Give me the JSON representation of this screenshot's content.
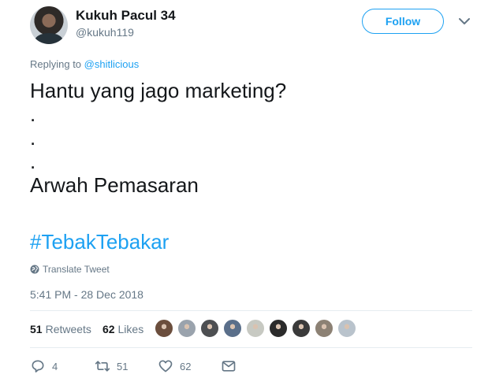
{
  "author": {
    "display_name": "Kukuh Pacul 34",
    "handle": "@kukuh119"
  },
  "follow_button": {
    "label": "Follow"
  },
  "reply": {
    "prefix": "Replying to",
    "mention": "@shitlicious"
  },
  "tweet": {
    "text": "Hantu yang jago marketing?\n.\n.\n.\nArwah Pemasaran",
    "hashtag": "#TebakTebakar",
    "translate_label": "Translate Tweet",
    "timestamp": "5:41 PM - 28 Dec 2018"
  },
  "stats": {
    "retweets_count": "51",
    "retweets_label": "Retweets",
    "likes_count": "62",
    "likes_label": "Likes"
  },
  "liker_avatars": [
    "#6b4e3d",
    "#9aa3ad",
    "#4d4f52",
    "#5a6f8a",
    "#c7c9c2",
    "#2b2b2b",
    "#3a3a3a",
    "#8c8174",
    "#b9c3cc"
  ],
  "actions": {
    "reply_count": "4",
    "retweet_count": "51",
    "like_count": "62"
  },
  "colors": {
    "accent": "#1da1f2",
    "muted": "#657786",
    "text": "#14171a",
    "divider": "#e6ecf0"
  },
  "icons": [
    "chevron-down-icon",
    "globe-icon",
    "reply-icon",
    "retweet-icon",
    "heart-icon",
    "message-icon"
  ]
}
